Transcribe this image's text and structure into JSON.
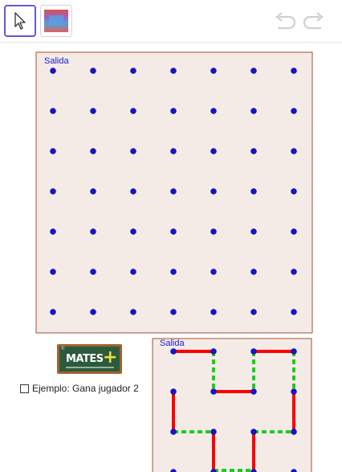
{
  "toolbar": {
    "tools": [
      {
        "name": "move",
        "icon": "cursor-arrow-icon",
        "selected": true
      },
      {
        "name": "image",
        "icon": "image-icon",
        "selected": false
      }
    ],
    "undo_icon": "undo-icon",
    "redo_icon": "redo-icon"
  },
  "boards": {
    "main": {
      "label": "Salida",
      "rows": 7,
      "cols": 7
    },
    "example": {
      "label": "Salida"
    }
  },
  "logo": {
    "text": "MATES",
    "symbol": "+",
    "mark": "®"
  },
  "example_checkbox": {
    "label": "Ejemplo: Gana jugador 2",
    "checked": false
  },
  "colors": {
    "board_fill": "#f4ebe7",
    "board_border": "#a0522d",
    "dot": "#1414cc",
    "red_line": "#ff0000",
    "green_dash": "#1fcc1f",
    "accent": "#6557d2"
  }
}
